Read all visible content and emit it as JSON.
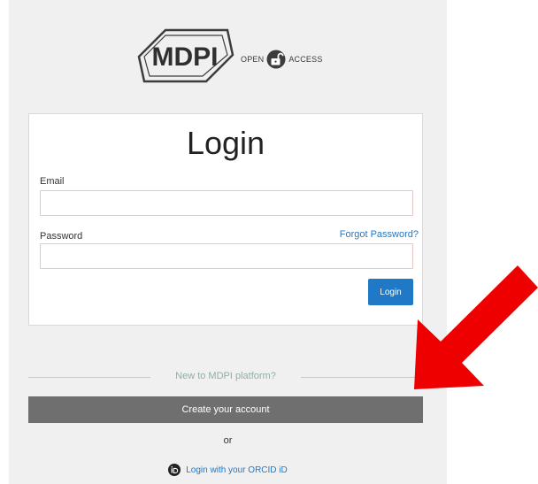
{
  "header": {
    "logo_text": "MDPI",
    "open_access_left": "OPEN",
    "open_access_right": "ACCESS"
  },
  "login_card": {
    "title": "Login",
    "email_label": "Email",
    "email_value": "",
    "password_label": "Password",
    "password_value": "",
    "forgot_link": "Forgot Password?",
    "login_button": "Login"
  },
  "signup": {
    "divider_text": "New to MDPI platform?",
    "create_button": "Create your account",
    "or_text": "or",
    "orcid_link": "Login with your ORCID iD"
  },
  "colors": {
    "primary": "#1f79c7",
    "create_button_bg": "#6f6f6f",
    "arrow": "#ee0000",
    "page_bg": "#f0f0f0"
  },
  "icons": {
    "open_access": "open-lock-icon",
    "orcid": "orcid-icon",
    "annotation": "red-arrow-icon"
  }
}
